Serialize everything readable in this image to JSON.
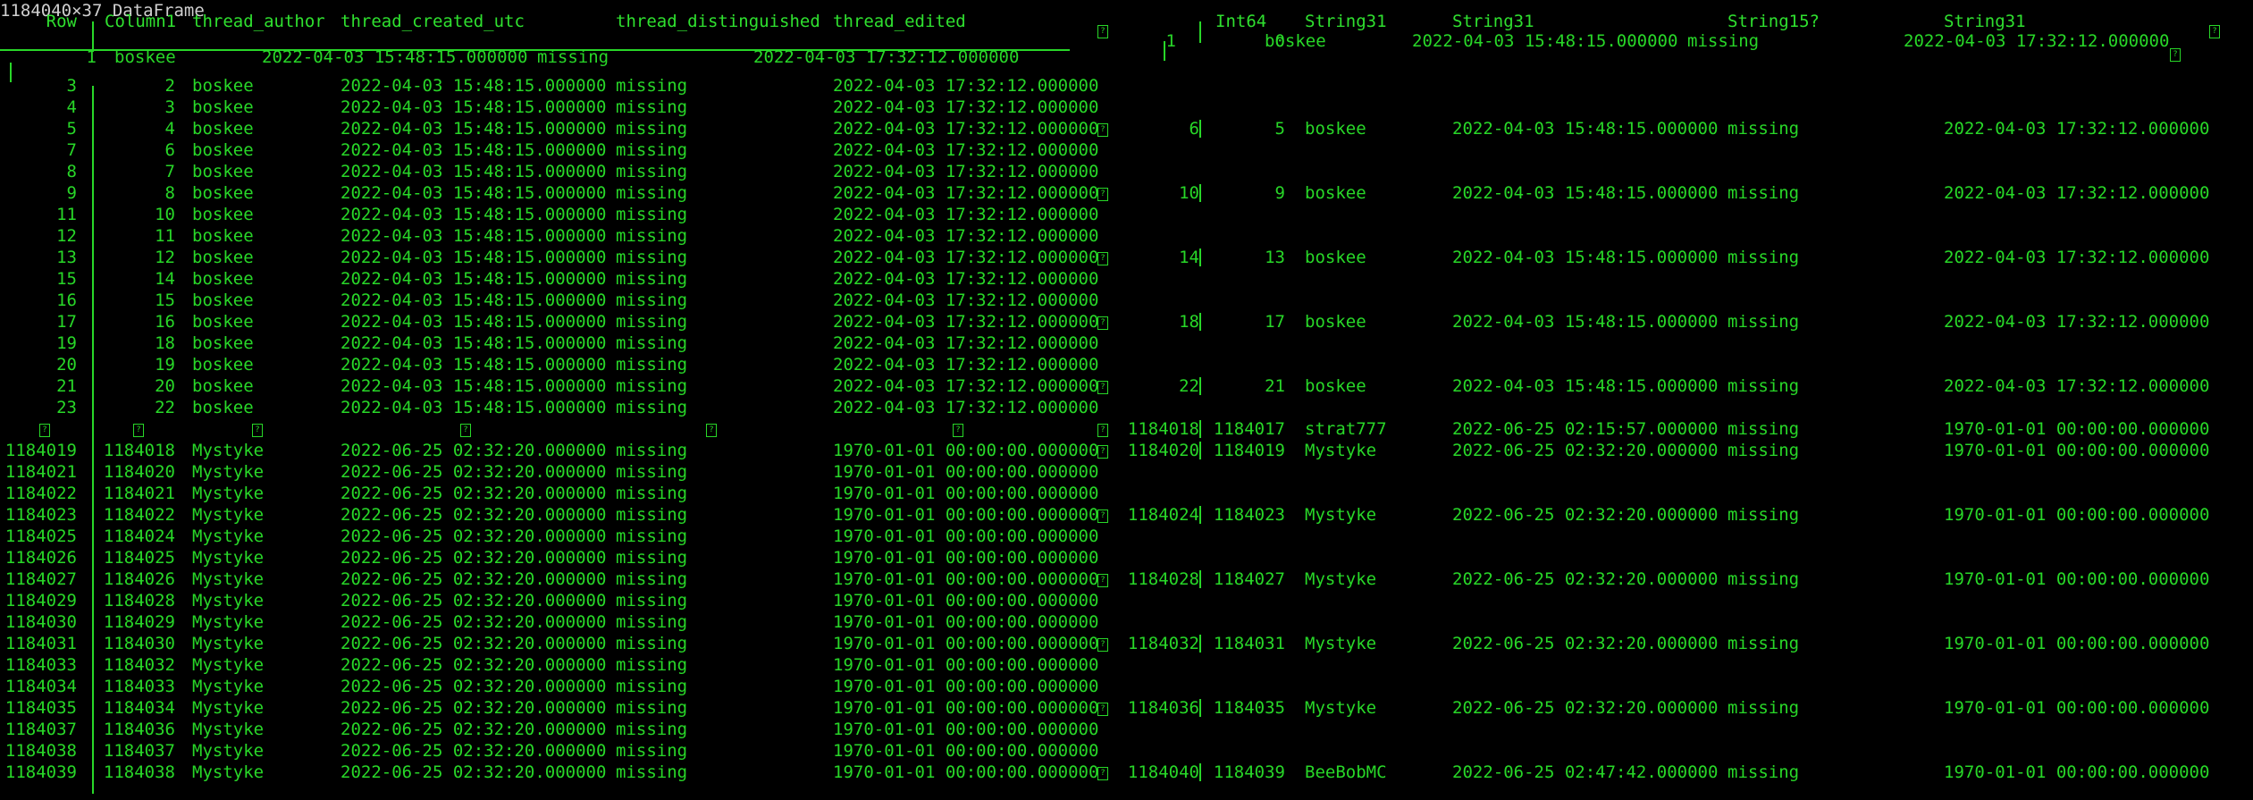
{
  "title": "1184040×37 DataFrame",
  "left": {
    "headers": [
      "Row",
      "Column1",
      "thread_author",
      "thread_created_utc",
      "thread_distinguished",
      "thread_edited"
    ],
    "first_row": {
      "row": "1",
      "author": "boskee",
      "created": "2022-04-03 15:48:15.000000",
      "dist": "missing",
      "edited": "2022-04-03 17:32:12.000000"
    },
    "rows": [
      [
        "3",
        "2",
        "boskee",
        "2022-04-03 15:48:15.000000",
        "missing",
        "2022-04-03 17:32:12.000000"
      ],
      [
        "4",
        "3",
        "boskee",
        "2022-04-03 15:48:15.000000",
        "missing",
        "2022-04-03 17:32:12.000000"
      ],
      [
        "5",
        "4",
        "boskee",
        "2022-04-03 15:48:15.000000",
        "missing",
        "2022-04-03 17:32:12.000000"
      ],
      [
        "7",
        "6",
        "boskee",
        "2022-04-03 15:48:15.000000",
        "missing",
        "2022-04-03 17:32:12.000000"
      ],
      [
        "8",
        "7",
        "boskee",
        "2022-04-03 15:48:15.000000",
        "missing",
        "2022-04-03 17:32:12.000000"
      ],
      [
        "9",
        "8",
        "boskee",
        "2022-04-03 15:48:15.000000",
        "missing",
        "2022-04-03 17:32:12.000000"
      ],
      [
        "11",
        "10",
        "boskee",
        "2022-04-03 15:48:15.000000",
        "missing",
        "2022-04-03 17:32:12.000000"
      ],
      [
        "12",
        "11",
        "boskee",
        "2022-04-03 15:48:15.000000",
        "missing",
        "2022-04-03 17:32:12.000000"
      ],
      [
        "13",
        "12",
        "boskee",
        "2022-04-03 15:48:15.000000",
        "missing",
        "2022-04-03 17:32:12.000000"
      ],
      [
        "15",
        "14",
        "boskee",
        "2022-04-03 15:48:15.000000",
        "missing",
        "2022-04-03 17:32:12.000000"
      ],
      [
        "16",
        "15",
        "boskee",
        "2022-04-03 15:48:15.000000",
        "missing",
        "2022-04-03 17:32:12.000000"
      ],
      [
        "17",
        "16",
        "boskee",
        "2022-04-03 15:48:15.000000",
        "missing",
        "2022-04-03 17:32:12.000000"
      ],
      [
        "19",
        "18",
        "boskee",
        "2022-04-03 15:48:15.000000",
        "missing",
        "2022-04-03 17:32:12.000000"
      ],
      [
        "20",
        "19",
        "boskee",
        "2022-04-03 15:48:15.000000",
        "missing",
        "2022-04-03 17:32:12.000000"
      ],
      [
        "21",
        "20",
        "boskee",
        "2022-04-03 15:48:15.000000",
        "missing",
        "2022-04-03 17:32:12.000000"
      ],
      [
        "23",
        "22",
        "boskee",
        "2022-04-03 15:48:15.000000",
        "missing",
        "2022-04-03 17:32:12.000000"
      ],
      [
        "1184019",
        "1184018",
        "Mystyke",
        "2022-06-25 02:32:20.000000",
        "missing",
        "1970-01-01 00:00:00.000000"
      ],
      [
        "1184021",
        "1184020",
        "Mystyke",
        "2022-06-25 02:32:20.000000",
        "missing",
        "1970-01-01 00:00:00.000000"
      ],
      [
        "1184022",
        "1184021",
        "Mystyke",
        "2022-06-25 02:32:20.000000",
        "missing",
        "1970-01-01 00:00:00.000000"
      ],
      [
        "1184023",
        "1184022",
        "Mystyke",
        "2022-06-25 02:32:20.000000",
        "missing",
        "1970-01-01 00:00:00.000000"
      ],
      [
        "1184025",
        "1184024",
        "Mystyke",
        "2022-06-25 02:32:20.000000",
        "missing",
        "1970-01-01 00:00:00.000000"
      ],
      [
        "1184026",
        "1184025",
        "Mystyke",
        "2022-06-25 02:32:20.000000",
        "missing",
        "1970-01-01 00:00:00.000000"
      ],
      [
        "1184027",
        "1184026",
        "Mystyke",
        "2022-06-25 02:32:20.000000",
        "missing",
        "1970-01-01 00:00:00.000000"
      ],
      [
        "1184029",
        "1184028",
        "Mystyke",
        "2022-06-25 02:32:20.000000",
        "missing",
        "1970-01-01 00:00:00.000000"
      ],
      [
        "1184030",
        "1184029",
        "Mystyke",
        "2022-06-25 02:32:20.000000",
        "missing",
        "1970-01-01 00:00:00.000000"
      ],
      [
        "1184031",
        "1184030",
        "Mystyke",
        "2022-06-25 02:32:20.000000",
        "missing",
        "1970-01-01 00:00:00.000000"
      ],
      [
        "1184033",
        "1184032",
        "Mystyke",
        "2022-06-25 02:32:20.000000",
        "missing",
        "1970-01-01 00:00:00.000000"
      ],
      [
        "1184034",
        "1184033",
        "Mystyke",
        "2022-06-25 02:32:20.000000",
        "missing",
        "1970-01-01 00:00:00.000000"
      ],
      [
        "1184035",
        "1184034",
        "Mystyke",
        "2022-06-25 02:32:20.000000",
        "missing",
        "1970-01-01 00:00:00.000000"
      ],
      [
        "1184037",
        "1184036",
        "Mystyke",
        "2022-06-25 02:32:20.000000",
        "missing",
        "1970-01-01 00:00:00.000000"
      ],
      [
        "1184038",
        "1184037",
        "Mystyke",
        "2022-06-25 02:32:20.000000",
        "missing",
        "1970-01-01 00:00:00.000000"
      ],
      [
        "1184039",
        "1184038",
        "Mystyke",
        "2022-06-25 02:32:20.000000",
        "missing",
        "1970-01-01 00:00:00.000000"
      ]
    ]
  },
  "right": {
    "types": [
      "Int64",
      "String31",
      "String31",
      "String15?",
      "String31"
    ],
    "first_row": {
      "row": "1",
      "col1": "0",
      "author": "boskee",
      "created": "2022-04-03 15:48:15.000000",
      "dist": "missing",
      "edited": "2022-04-03 17:32:12.000000"
    },
    "rows": [
      {
        "line": 5,
        "row": "6",
        "col1": "5",
        "author": "boskee",
        "created": "2022-04-03 15:48:15.000000",
        "dist": "missing",
        "edited": "2022-04-03 17:32:12.000000"
      },
      {
        "line": 8,
        "row": "10",
        "col1": "9",
        "author": "boskee",
        "created": "2022-04-03 15:48:15.000000",
        "dist": "missing",
        "edited": "2022-04-03 17:32:12.000000"
      },
      {
        "line": 11,
        "row": "14",
        "col1": "13",
        "author": "boskee",
        "created": "2022-04-03 15:48:15.000000",
        "dist": "missing",
        "edited": "2022-04-03 17:32:12.000000"
      },
      {
        "line": 14,
        "row": "18",
        "col1": "17",
        "author": "boskee",
        "created": "2022-04-03 15:48:15.000000",
        "dist": "missing",
        "edited": "2022-04-03 17:32:12.000000"
      },
      {
        "line": 17,
        "row": "22",
        "col1": "21",
        "author": "boskee",
        "created": "2022-04-03 15:48:15.000000",
        "dist": "missing",
        "edited": "2022-04-03 17:32:12.000000"
      },
      {
        "line": 19,
        "row": "1184018",
        "col1": "1184017",
        "author": "strat777",
        "created": "2022-06-25 02:15:57.000000",
        "dist": "missing",
        "edited": "1970-01-01 00:00:00.000000"
      },
      {
        "line": 20,
        "row": "1184020",
        "col1": "1184019",
        "author": "Mystyke",
        "created": "2022-06-25 02:32:20.000000",
        "dist": "missing",
        "edited": "1970-01-01 00:00:00.000000"
      },
      {
        "line": 23,
        "row": "1184024",
        "col1": "1184023",
        "author": "Mystyke",
        "created": "2022-06-25 02:32:20.000000",
        "dist": "missing",
        "edited": "1970-01-01 00:00:00.000000"
      },
      {
        "line": 26,
        "row": "1184028",
        "col1": "1184027",
        "author": "Mystyke",
        "created": "2022-06-25 02:32:20.000000",
        "dist": "missing",
        "edited": "1970-01-01 00:00:00.000000"
      },
      {
        "line": 29,
        "row": "1184032",
        "col1": "1184031",
        "author": "Mystyke",
        "created": "2022-06-25 02:32:20.000000",
        "dist": "missing",
        "edited": "1970-01-01 00:00:00.000000"
      },
      {
        "line": 32,
        "row": "1184036",
        "col1": "1184035",
        "author": "Mystyke",
        "created": "2022-06-25 02:32:20.000000",
        "dist": "missing",
        "edited": "1970-01-01 00:00:00.000000"
      },
      {
        "line": 35,
        "row": "1184040",
        "col1": "1184039",
        "author": "BeeBobMC",
        "created": "2022-06-25 02:47:42.000000",
        "dist": "missing",
        "edited": "1970-01-01 00:00:00.000000"
      }
    ]
  },
  "glyph_icon": "replacement-glyph-icon"
}
